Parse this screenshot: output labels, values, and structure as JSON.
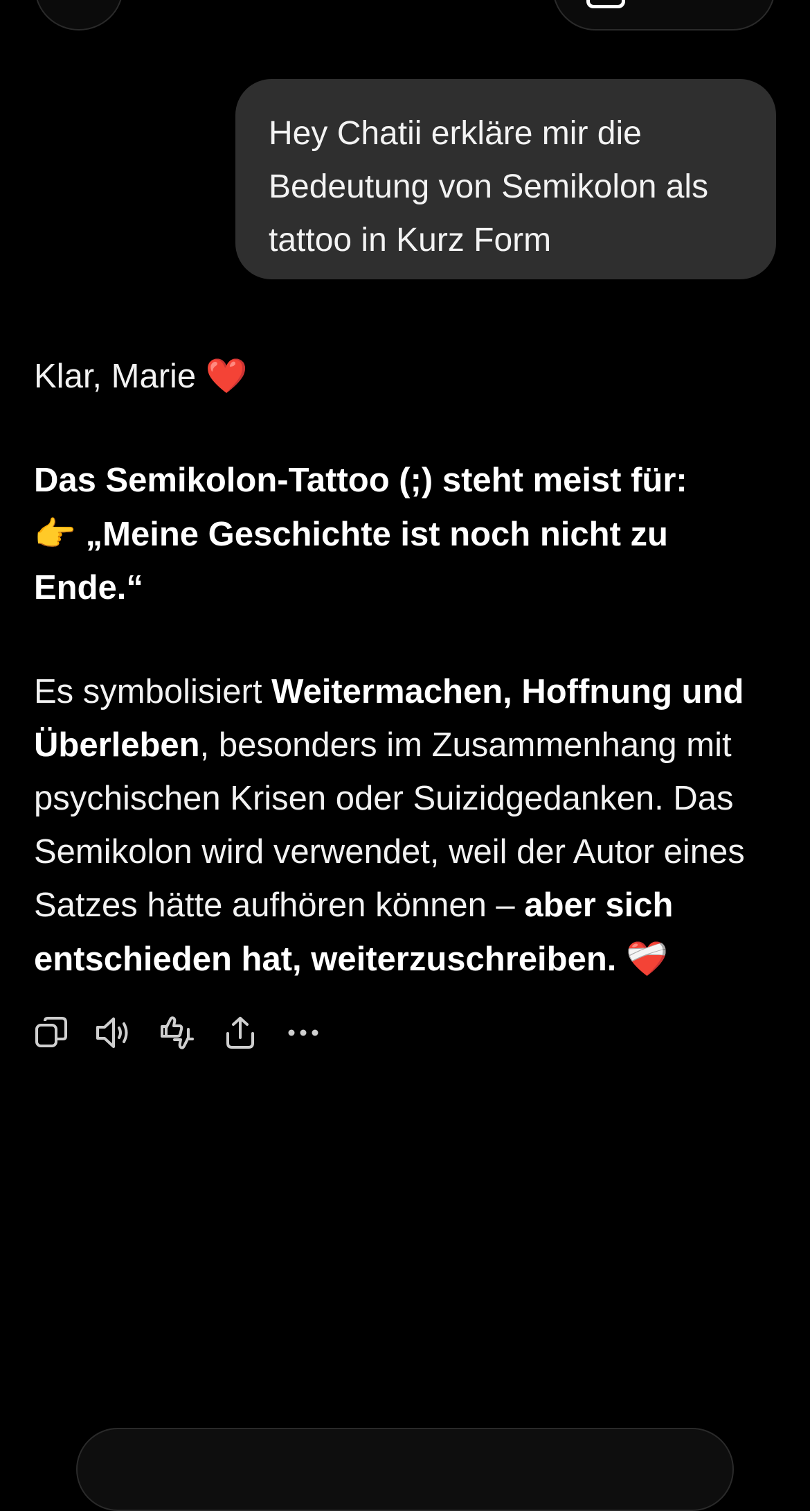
{
  "user_message": {
    "text": "Hey Chatii erkläre mir die Bedeutung von Semikolon als tattoo in Kurz Form"
  },
  "assistant_message": {
    "greeting": "Klar, Marie",
    "greeting_emoji": "❤️",
    "heading": "Das Semikolon-Tattoo (;) steht meist für:",
    "quote_emoji": "👉",
    "quote": "„Meine Geschichte ist noch nicht zu Ende.“",
    "p2_start": "Es symbolisiert ",
    "p2_bold": "Weitermachen, Hoffnung und Überleben",
    "p2_middle": ", besonders im Zusammenhang mit psychischen Krisen oder Suizidgedanken. Das Semikolon wird verwendet, weil der Autor eines Satzes hätte aufhören können – ",
    "p2_end_bold": "aber sich entschieden hat, weiterzuschreiben.",
    "end_emoji": "❤️‍🩹"
  },
  "actions": [
    {
      "name": "copy",
      "icon": "copy-icon"
    },
    {
      "name": "read-aloud",
      "icon": "speaker-icon"
    },
    {
      "name": "feedback",
      "icon": "thumbs-up-down-icon"
    },
    {
      "name": "share",
      "icon": "share-icon"
    },
    {
      "name": "more",
      "icon": "more-icon"
    }
  ],
  "colors": {
    "background": "#000000",
    "user_bubble": "#2f2f2f",
    "text": "#f2f2f2",
    "heart": "#ff2a36"
  }
}
